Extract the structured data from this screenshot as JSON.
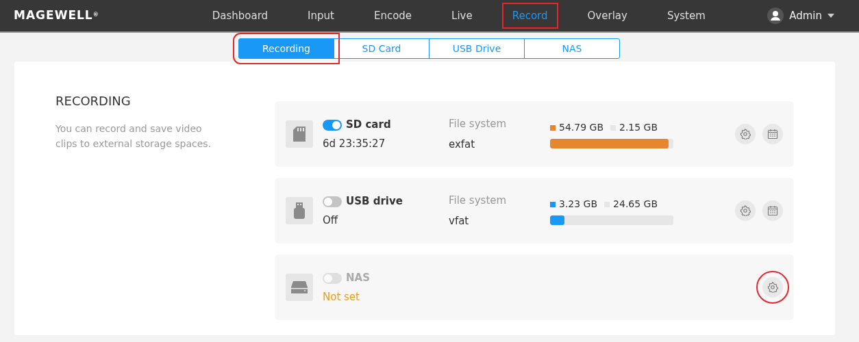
{
  "logo": "MAGEWELL$^{®}$",
  "nav": [
    {
      "label": "Dashboard",
      "selected": false,
      "highlighted": false
    },
    {
      "label": "Input",
      "selected": false,
      "highlighted": false
    },
    {
      "label": "Encode",
      "selected": false,
      "highlighted": false
    },
    {
      "label": "Live",
      "selected": false,
      "highlighted": false
    },
    {
      "label": "Record",
      "selected": true,
      "highlighted": true
    },
    {
      "label": "Overlay",
      "selected": false,
      "highlighted": false
    },
    {
      "label": "System",
      "selected": false,
      "highlighted": false
    }
  ],
  "user": {
    "name": "Admin"
  },
  "tabs": [
    {
      "label": "Recording",
      "selected": true,
      "highlighted": true
    },
    {
      "label": "SD Card",
      "selected": false,
      "highlighted": false
    },
    {
      "label": "USB Drive",
      "selected": false,
      "highlighted": false
    },
    {
      "label": "NAS",
      "selected": false,
      "highlighted": false
    }
  ],
  "section": {
    "title": "RECORDING",
    "description": "You can record and save video clips to external storage spaces."
  },
  "devices": [
    {
      "kind": "sd",
      "name": "SD card",
      "on": true,
      "disabled": false,
      "status": "6d 23:35:27",
      "warning": false,
      "fs_label": "File system",
      "fs_value": "exfat",
      "used": "54.79 GB",
      "free": "2.15 GB",
      "level": 0.962,
      "color": "#e6862e",
      "actions": [
        {
          "kind": "settings",
          "highlighted": false
        },
        {
          "kind": "schedule",
          "highlighted": false
        }
      ]
    },
    {
      "kind": "usb",
      "name": "USB drive",
      "on": false,
      "disabled": false,
      "status": "Off",
      "warning": false,
      "fs_label": "File system",
      "fs_value": "vfat",
      "used": "3.23 GB",
      "free": "24.65 GB",
      "level": 0.116,
      "color": "#1a98f7",
      "actions": [
        {
          "kind": "settings",
          "highlighted": false
        },
        {
          "kind": "schedule",
          "highlighted": false
        }
      ]
    },
    {
      "kind": "nas",
      "name": "NAS",
      "on": false,
      "disabled": true,
      "status": "Not set",
      "warning": true,
      "actions": [
        {
          "kind": "settings",
          "highlighted": true
        }
      ]
    }
  ]
}
